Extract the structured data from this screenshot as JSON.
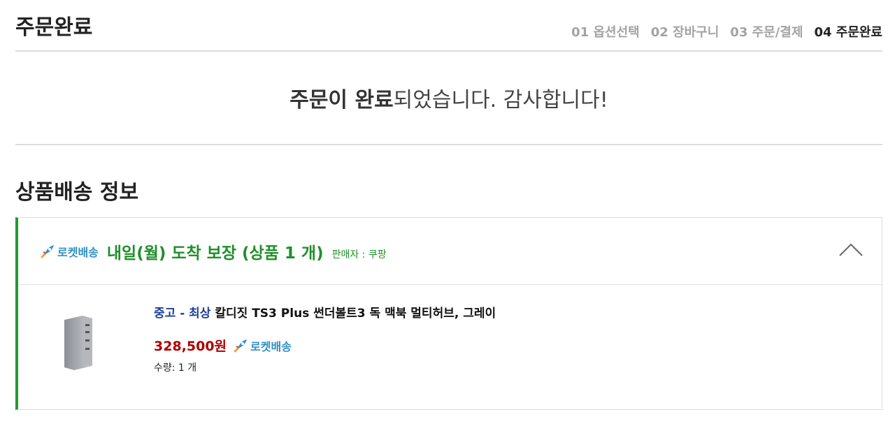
{
  "header": {
    "title": "주문완료",
    "steps": [
      {
        "label": "01 옵션선택",
        "active": false
      },
      {
        "label": "02 장바구니",
        "active": false
      },
      {
        "label": "03 주문/결제",
        "active": false
      },
      {
        "label": "04 주문완료",
        "active": true
      }
    ]
  },
  "complete_message": {
    "bold": "주문이 완료",
    "rest": "되었습니다. 감사합니다!"
  },
  "section": {
    "title": "상품배송 정보"
  },
  "delivery": {
    "badge_label": "로켓배송",
    "arrival_text": "내일(월) 도착 보장 (상품 1 개)",
    "seller": "판매자 : 쿠팡",
    "toggle_icon": "chevron-up-icon",
    "accent_color": "#1f9a2f"
  },
  "product": {
    "grade": "중고 - 최상",
    "name": "칼디짓 TS3 Plus 썬더볼트3 독 맥북 멀티허브, 그레이",
    "price": "328,500원",
    "badge_label": "로켓배송",
    "quantity": "수량: 1 개",
    "image_icon": "product-dock-image"
  }
}
